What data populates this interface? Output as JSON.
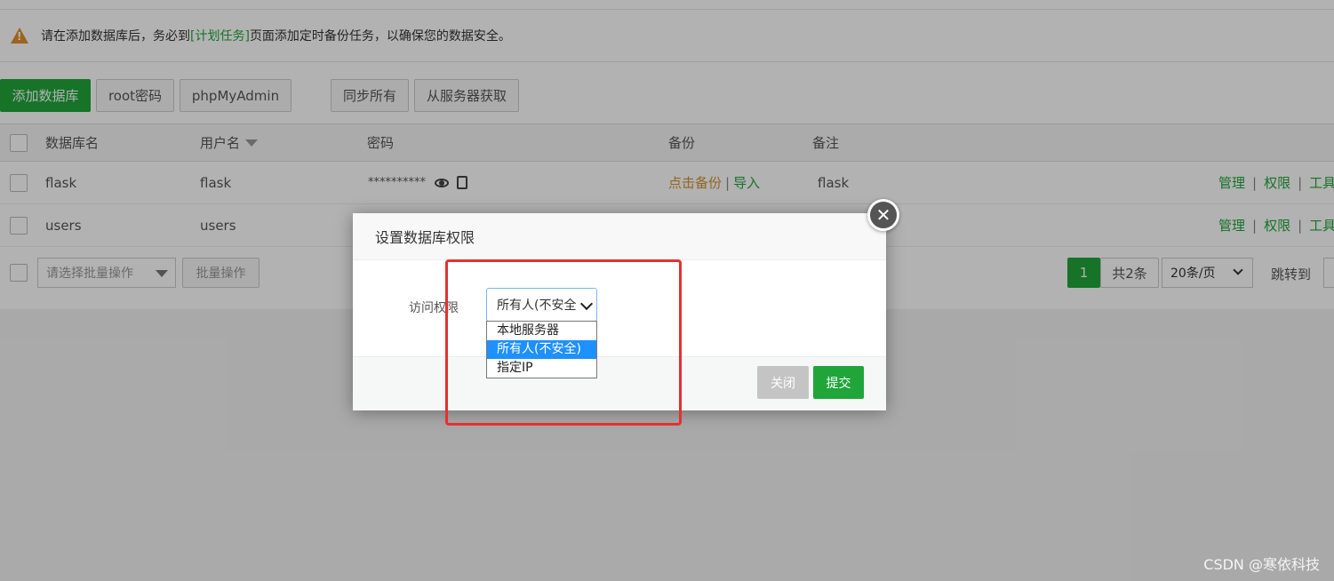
{
  "notice": {
    "prefix": "请在添加数据库后，务必到",
    "link": "[计划任务]",
    "suffix": "页面添加定时备份任务，以确保您的数据安全。"
  },
  "toolbar": {
    "add_db": "添加数据库",
    "root_pw": "root密码",
    "phpmyadmin": "phpMyAdmin",
    "sync_all": "同步所有",
    "fetch_server": "从服务器获取"
  },
  "table": {
    "headers": {
      "name": "数据库名",
      "user": "用户名",
      "password": "密码",
      "backup": "备份",
      "remark": "备注"
    },
    "rows": [
      {
        "name": "flask",
        "user": "flask",
        "password": "**********",
        "backup": "点击备份",
        "import": "导入",
        "remark": "flask",
        "manage": "管理",
        "perm": "权限",
        "tools": "工具"
      },
      {
        "name": "users",
        "user": "users",
        "manage": "管理",
        "perm": "权限",
        "tools": "工具"
      }
    ],
    "separator": "|"
  },
  "footer": {
    "batch_placeholder": "请选择批量操作",
    "batch_button": "批量操作",
    "page_current": "1",
    "total": "共2条",
    "per_page": "20条/页",
    "jump_to": "跳转到"
  },
  "dialog": {
    "title": "设置数据库权限",
    "access_label": "访问权限",
    "selected": "所有人(不安全)",
    "options": [
      "本地服务器",
      "所有人(不安全)",
      "指定IP"
    ],
    "close_label": "关闭",
    "submit_label": "提交"
  },
  "watermark": "CSDN @寒依科技",
  "colors": {
    "accent_green": "#20a53a",
    "warning_orange": "#e0902c",
    "backup_orange": "#d09134",
    "highlight_red": "#e53030",
    "select_blue": "#1e90ff"
  }
}
